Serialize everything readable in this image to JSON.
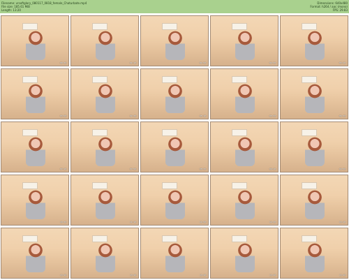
{
  "header": {
    "left_lines": [
      "Filename: vrsoftglory_080117_0818_female_Chaturbate.mp4",
      "File size: 185.61 MiB",
      "Length: 13:20"
    ],
    "right_lines": [
      "Dimensions: 640x480",
      "Format: h264 / aac (mono)",
      "FPS: 29.83"
    ]
  },
  "thumbnails": [
    {
      "time": "00:30"
    },
    {
      "time": "01:10"
    },
    {
      "time": "01:50"
    },
    {
      "time": "02:30"
    },
    {
      "time": "03:10"
    },
    {
      "time": "03:50"
    },
    {
      "time": "04:30"
    },
    {
      "time": "05:10"
    },
    {
      "time": "05:50"
    },
    {
      "time": "06:30"
    },
    {
      "time": "07:10"
    },
    {
      "time": "07:50"
    },
    {
      "time": "08:30"
    },
    {
      "time": "09:10"
    },
    {
      "time": "09:50"
    },
    {
      "time": "10:30"
    },
    {
      "time": "11:10"
    },
    {
      "time": "11:50"
    },
    {
      "time": "12:30"
    },
    {
      "time": "13:10"
    },
    {
      "time": "13:20"
    },
    {
      "time": "13:20"
    },
    {
      "time": "13:20"
    },
    {
      "time": "13:20"
    },
    {
      "time": "13:20"
    }
  ]
}
